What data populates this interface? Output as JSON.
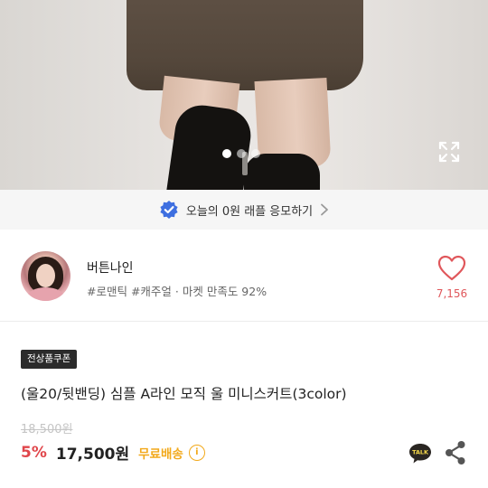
{
  "carousel": {
    "total_slides": 3,
    "active_index": 0
  },
  "event_banner": {
    "text": "오늘의 0원 래플 응모하기"
  },
  "seller": {
    "name": "버튼나인",
    "tags": "#로맨틱 #캐주얼 · 마켓 만족도 92%",
    "likes": "7,156"
  },
  "product": {
    "coupon_badge": "전상품쿠폰",
    "title": "(울20/뒷밴딩) 심플 A라인 모직 울 미니스커트(3color)",
    "original_price": "18,500원",
    "discount": "5%",
    "price": "17,500원",
    "shipping": "무료배송",
    "info_icon_label": "i"
  },
  "icons": {
    "talk_label": "TALK"
  },
  "colors": {
    "discount": "#e0464b",
    "shipping": "#f2a91b",
    "heart": "#e0575b",
    "verified": "#3e6fe0"
  }
}
